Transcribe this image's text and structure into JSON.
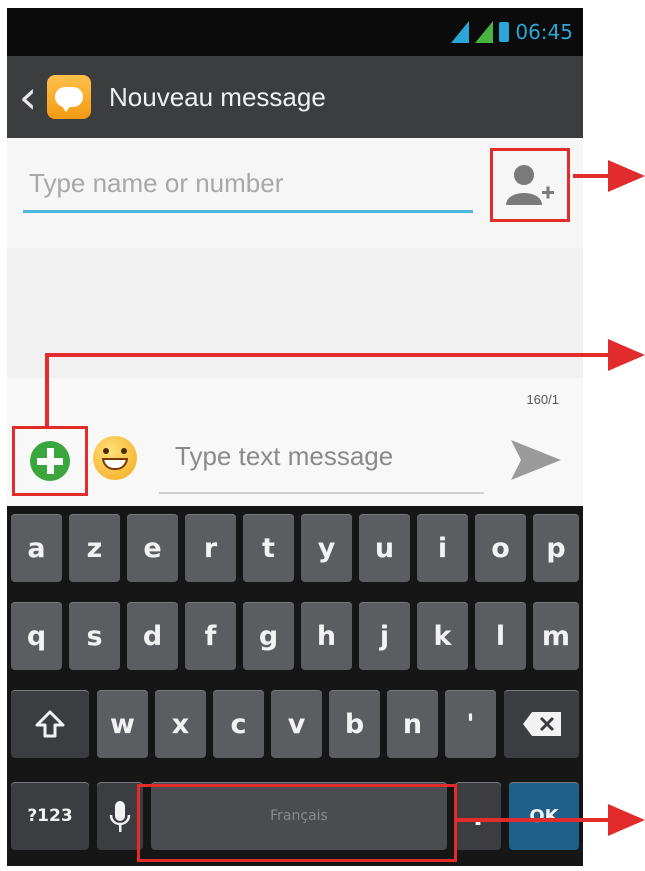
{
  "status_bar": {
    "time": "06:45",
    "accent_color": "#2aa7d8"
  },
  "action_bar": {
    "back_icon": "chevron-left-icon",
    "app_icon": "message-icon",
    "title": "Nouveau message"
  },
  "recipient": {
    "placeholder": "Type name or number",
    "add_contact_icon": "add-contact-icon"
  },
  "compose": {
    "char_counter": "160/1",
    "attach_icon": "plus-icon",
    "emoji_icon": "smiley-icon",
    "placeholder": "Type text message",
    "send_icon": "send-icon"
  },
  "keyboard": {
    "row1": [
      "a",
      "z",
      "e",
      "r",
      "t",
      "y",
      "u",
      "i",
      "o",
      "p"
    ],
    "row2": [
      "q",
      "s",
      "d",
      "f",
      "g",
      "h",
      "j",
      "k",
      "l",
      "m"
    ],
    "row3": [
      "w",
      "x",
      "c",
      "v",
      "b",
      "n",
      "'"
    ],
    "row4": {
      "symbols": "?123",
      "space_label": "Français",
      "dot": ".",
      "ok": "OK"
    }
  },
  "annotation_color": "#e22b2b"
}
